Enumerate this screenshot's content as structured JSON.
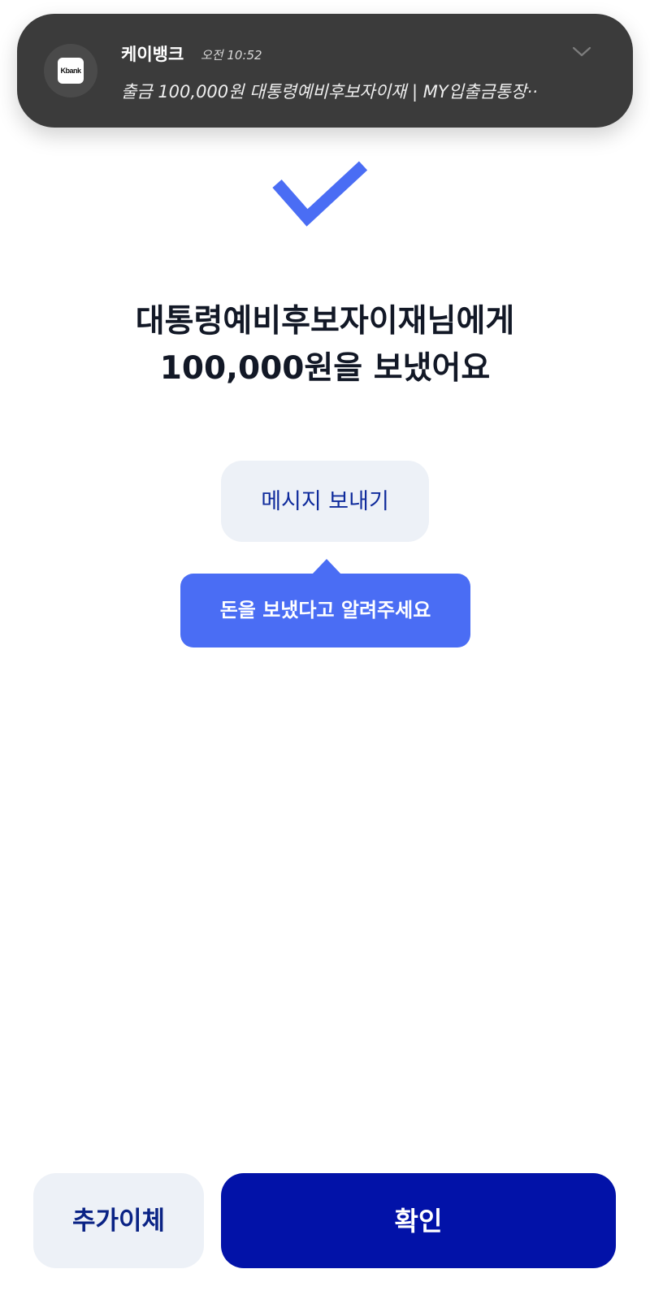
{
  "notification": {
    "logo_text": "Kbank",
    "app_name": "케이뱅크",
    "time": "오전 10:52",
    "body": "출금 100,000원 대통령예비후보자이재 | MY입출금통장··",
    "expand_icon": "chevron-down-icon"
  },
  "status": {
    "icon": "check-icon",
    "accent_color": "#4a6df4"
  },
  "result": {
    "title_line1": "대통령예비후보자이재님에게",
    "title_line2": "100,000원을 보냈어요"
  },
  "message": {
    "button_label": "메시지 보내기",
    "tooltip": "돈을 보냈다고 알려주세요"
  },
  "actions": {
    "more_transfer_label": "추가이체",
    "confirm_label": "확인",
    "confirm_color": "#0212a8"
  }
}
